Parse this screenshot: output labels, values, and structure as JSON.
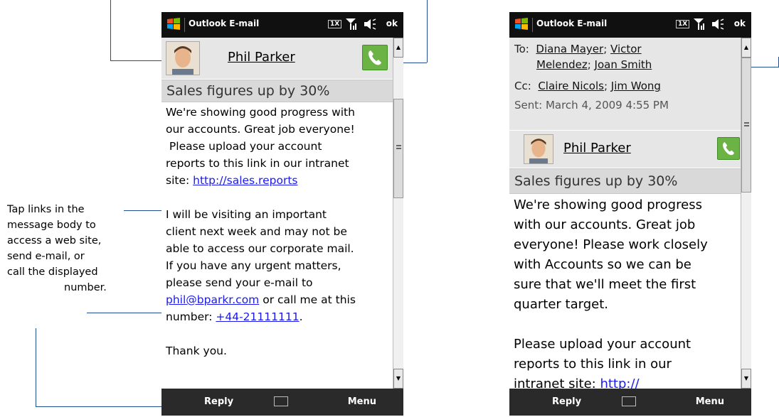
{
  "callouts": {
    "links": {
      "lines": [
        "Tap links in the",
        "message body to",
        "access a web site,",
        "send e-mail, or",
        "call the displayed",
        "number."
      ]
    }
  },
  "left_phone": {
    "titlebar": {
      "title": "Outlook E-mail",
      "status_1x": "1X",
      "ok": "ok"
    },
    "sender": {
      "name": "Phil Parker"
    },
    "subject": "Sales figures up by 30%",
    "body": {
      "p1": [
        "We're showing good progress with",
        "our accounts. Great job everyone!",
        " Please upload your account",
        "reports to this link in our intranet"
      ],
      "p1_site_prefix": "site: ",
      "p1_link": "http://sales.reports",
      "p2": [
        "I will be visiting an important",
        "client next week and may not be",
        "able to access our corporate mail.",
        "If you have any urgent matters,",
        "please send your e-mail to"
      ],
      "email_link": "phil@bparkr.com",
      "after_email": " or call me at this",
      "number_prefix": "number: ",
      "phone_link": "+44-21111111",
      "after_phone": ".",
      "p3": "Thank you."
    },
    "softkeys": {
      "left": "Reply",
      "right": "Menu"
    }
  },
  "right_phone": {
    "titlebar": {
      "title": "Outlook E-mail",
      "status_1x": "1X",
      "ok": "ok"
    },
    "header": {
      "to_label": "To:",
      "to_1": "Diana Mayer",
      "to_2": "Victor",
      "to_3": "Melendez",
      "to_4": "Joan Smith",
      "cc_label": "Cc:",
      "cc_1": "Claire Nicols",
      "cc_2": "Jim Wong",
      "sent": "Sent: March 4, 2009 4:55 PM"
    },
    "sender": {
      "name": "Phil Parker"
    },
    "subject": "Sales figures up by 30%",
    "body": {
      "lines": [
        "We're showing good progress",
        "with our accounts. Great job",
        "everyone! Please work closely",
        "with Accounts so we can be",
        "sure that we'll meet the first",
        "quarter target."
      ],
      "lines2": [
        "Please upload your account",
        "reports to this link in our"
      ],
      "last_prefix": "intranet site: ",
      "last_link": "http://"
    },
    "softkeys": {
      "left": "Reply",
      "right": "Menu"
    }
  },
  "colors": {
    "link": "#1a1aee",
    "callout_line": "#1f4e8c",
    "call_green": "#6ab344",
    "titlebar": "#101010"
  },
  "icons": [
    "windows-logo-icon",
    "signal-icon",
    "volume-icon",
    "phone-call-icon",
    "keyboard-icon",
    "scroll-up-icon",
    "scroll-down-icon"
  ]
}
